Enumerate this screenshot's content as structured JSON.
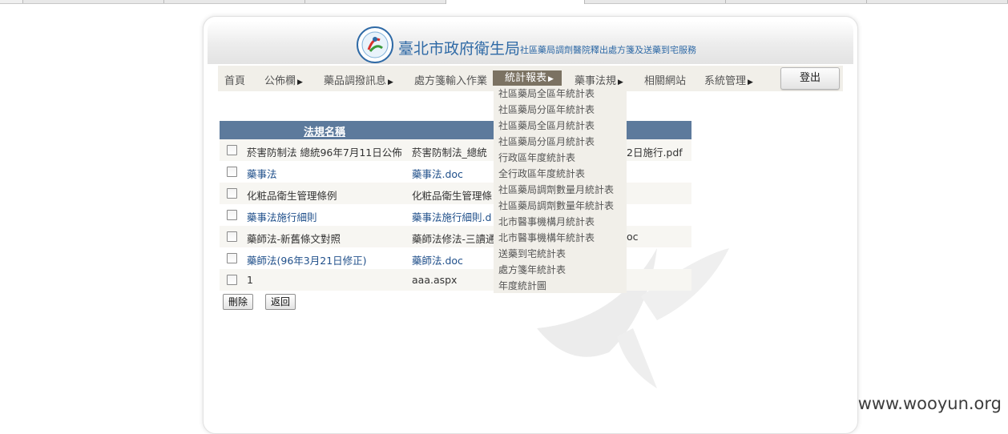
{
  "header": {
    "title": "臺北市政府衛生局",
    "subtitle": "社區藥局調劑醫院釋出處方箋及送藥到宅服務"
  },
  "nav": {
    "items": [
      {
        "label": "首頁",
        "has_submenu": false
      },
      {
        "label": "公佈欄",
        "has_submenu": true
      },
      {
        "label": "藥品調撥訊息",
        "has_submenu": true
      },
      {
        "label": "處方箋輸入作業",
        "has_submenu": false
      },
      {
        "label": "統計報表",
        "has_submenu": true,
        "active": true
      },
      {
        "label": "藥事法規",
        "has_submenu": true
      },
      {
        "label": "相關網站",
        "has_submenu": false
      },
      {
        "label": "系統管理",
        "has_submenu": true
      }
    ],
    "arrow_glyph": "▶",
    "logout_label": "登出"
  },
  "dropdown": {
    "items": [
      "社區藥局全區年統計表",
      "社區藥局分區年統計表",
      "社區藥局全區月統計表",
      "社區藥局分區月統計表",
      "行政區年度統計表",
      "全行政區年度統計表",
      "社區藥局調劑數量月統計表",
      "社區藥局調劑數量年統計表",
      "北市醫事機構月統計表",
      "北市醫事機構年統計表",
      "送藥到宅統計表",
      "處方箋年統計表",
      "年度統計圖"
    ]
  },
  "table": {
    "header_label": "法規名稱",
    "rows": [
      {
        "name": "菸害防制法 總統96年7月11日公佈",
        "file": "菸害防制法_總統",
        "file_tail": "2日施行.pdf",
        "name_link": false,
        "file_link": false
      },
      {
        "name": "藥事法",
        "file": "藥事法.doc",
        "file_tail": "",
        "name_link": true,
        "file_link": true
      },
      {
        "name": "化粧品衛生管理條例",
        "file": "化粧品衛生管理條",
        "file_tail": "",
        "name_link": false,
        "file_link": false
      },
      {
        "name": "藥事法施行細則",
        "file": "藥事法施行細則.d",
        "file_tail": "",
        "name_link": true,
        "file_link": true
      },
      {
        "name": "藥師法-新舊條文對照",
        "file": "藥師法修法-三讀通",
        "file_tail": "oc",
        "name_link": false,
        "file_link": false
      },
      {
        "name": "藥師法(96年3月21日修正)",
        "file": "藥師法.doc",
        "file_tail": "",
        "name_link": true,
        "file_link": true
      },
      {
        "name": "1",
        "file": "aaa.aspx",
        "file_tail": "",
        "name_link": false,
        "file_link": false
      }
    ]
  },
  "buttons": {
    "delete_label": "刪除",
    "back_label": "返回"
  },
  "footer": {
    "site_mark": "www.wooyun.org"
  },
  "colors": {
    "table_header_bg": "#5d7a9c",
    "nav_active_bg": "#7b7262",
    "nav_bg": "#f1efe9",
    "link": "#1f4f8a",
    "title_blue": "#2f6aa6"
  },
  "icons": [
    "agency-logo-icon",
    "submenu-arrow-icon",
    "checkbox"
  ]
}
